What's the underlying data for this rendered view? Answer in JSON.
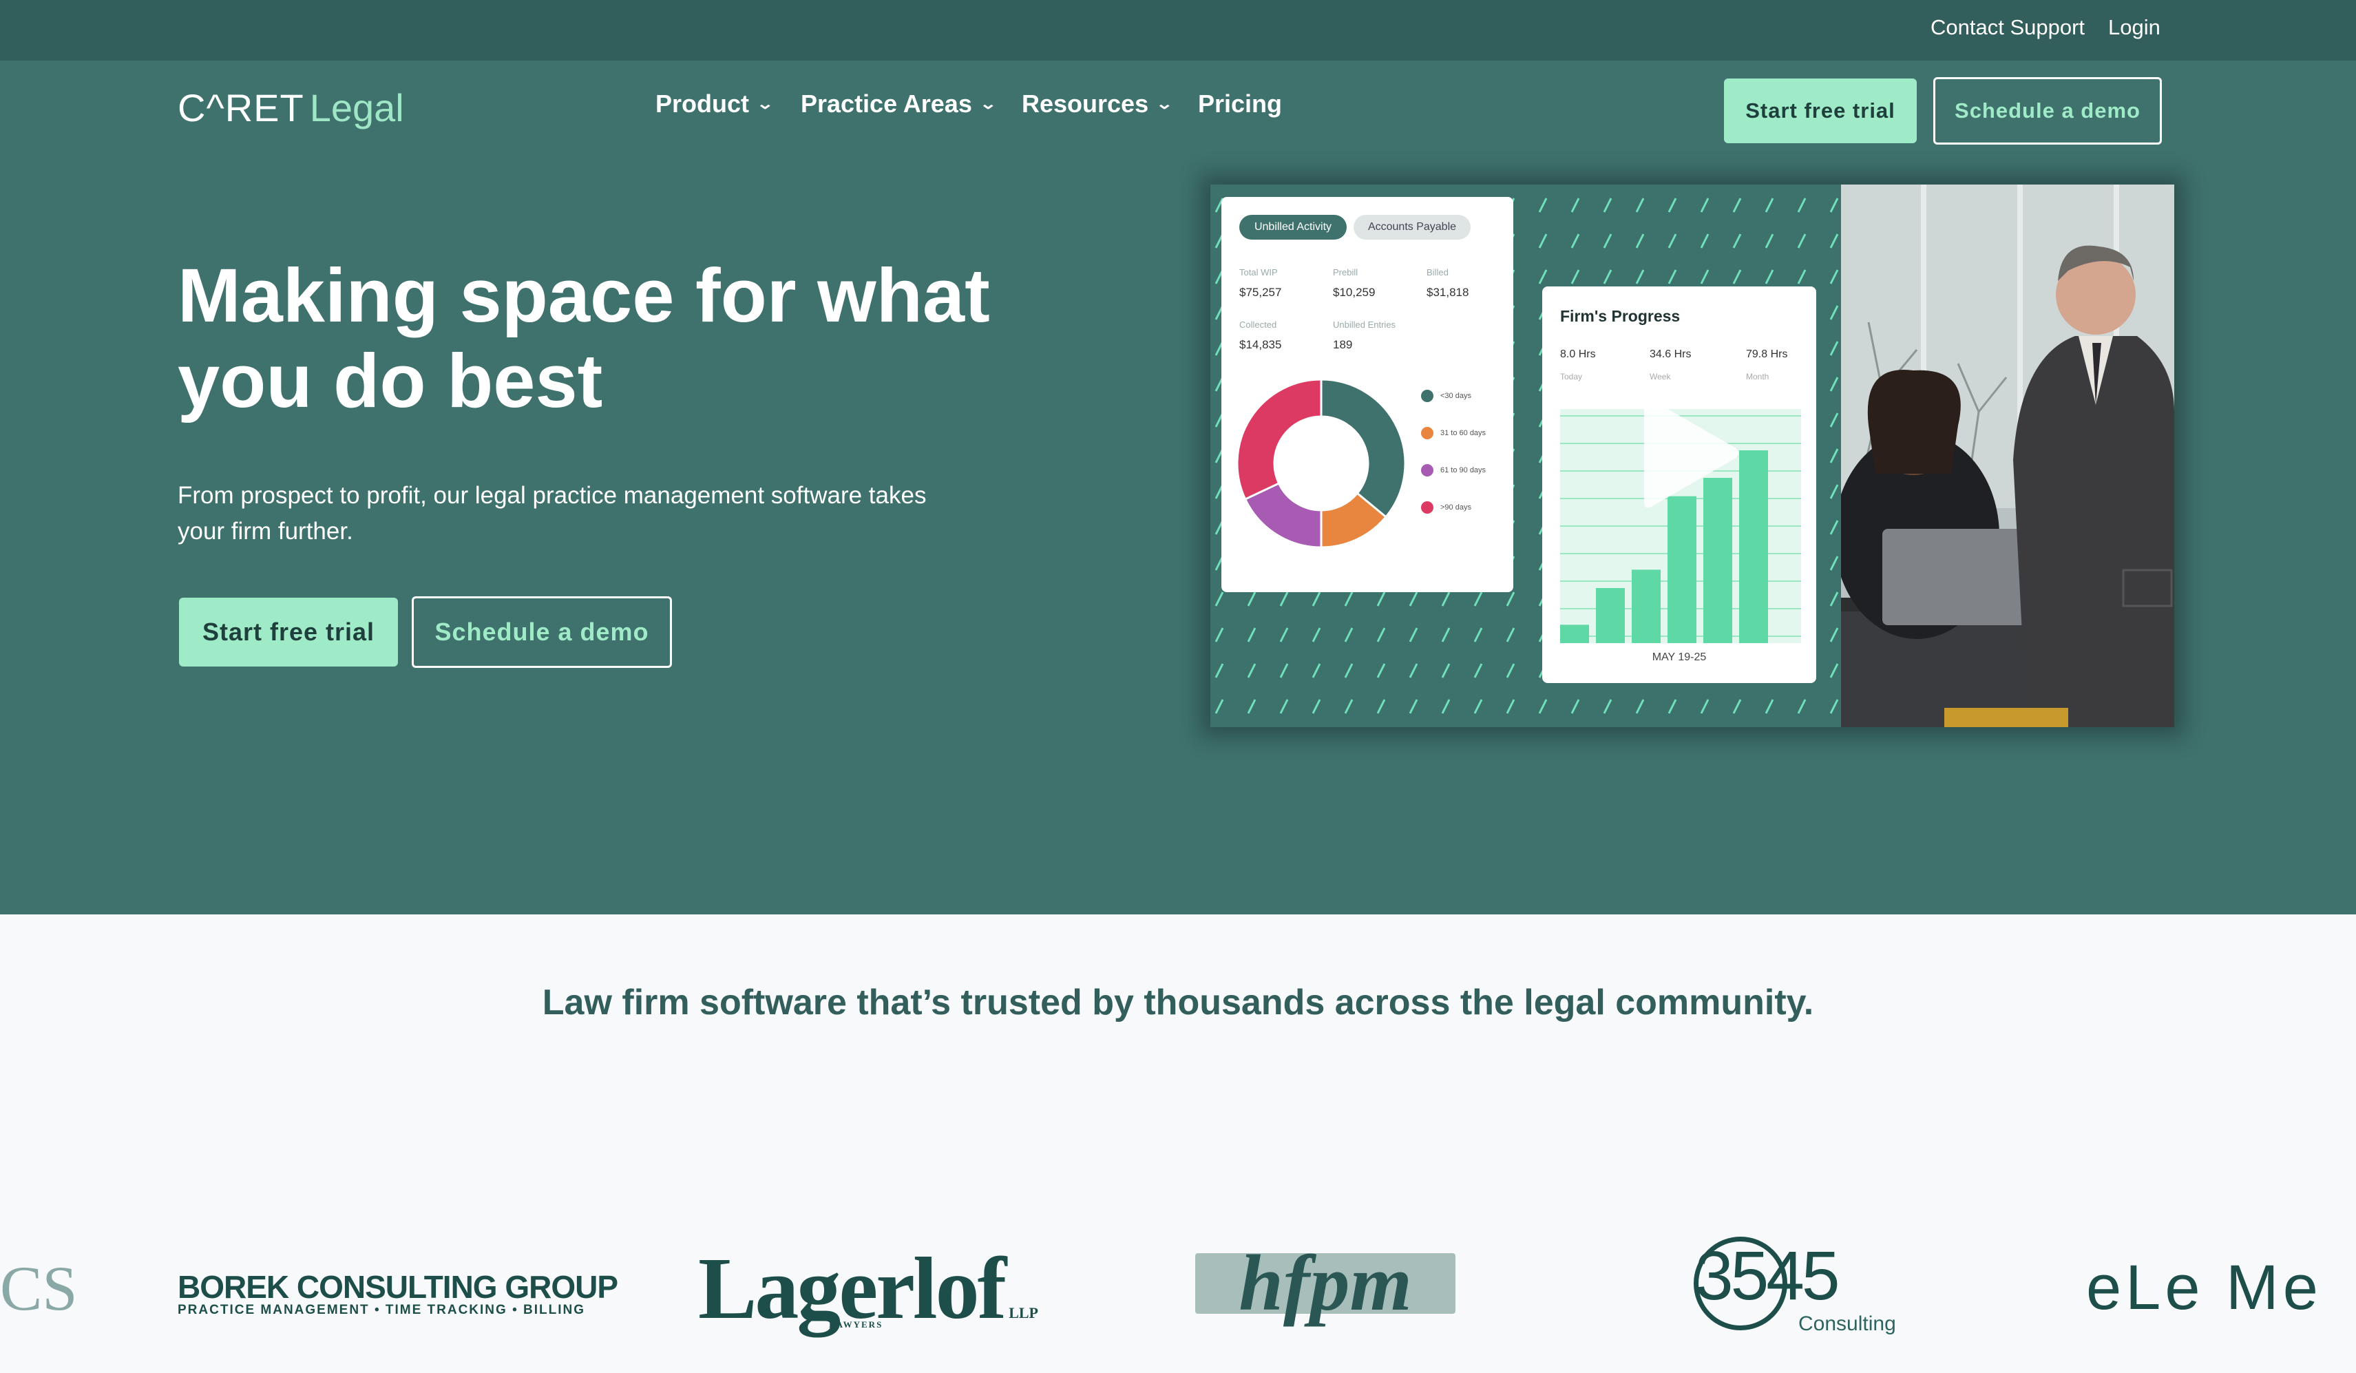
{
  "topbar": {
    "contact_label": "Contact Support",
    "login_label": "Login"
  },
  "brand": {
    "name_part1": "C^RET",
    "name_part2": "Legal"
  },
  "nav": {
    "items": [
      {
        "label": "Product"
      },
      {
        "label": "Practice Areas"
      },
      {
        "label": "Resources"
      },
      {
        "label": "Pricing"
      }
    ],
    "chevron_icon": "chevron-down-icon"
  },
  "header_buttons": {
    "trial_label": "Start free trial",
    "demo_label": "Schedule a demo"
  },
  "hero": {
    "headline": "Making space for what you do best",
    "subcopy": "From prospect to profit, our legal practice management software takes your firm further.",
    "trial_label": "Start free trial",
    "demo_label": "Schedule a demo"
  },
  "dashboard": {
    "tabs": [
      "Unbilled Activity",
      "Accounts Payable"
    ],
    "kpis": [
      {
        "label": "Total WIP",
        "value": "$75,257"
      },
      {
        "label": "Prebill",
        "value": "$10,259"
      },
      {
        "label": "Billed",
        "value": "$31,818"
      },
      {
        "label": "Collected",
        "value": "$14,835"
      },
      {
        "label": "Unbilled Entries",
        "value": "189"
      }
    ],
    "aging_legend": [
      "<30 days",
      "31 to 60 days",
      "61 to 90 days",
      ">90 days"
    ],
    "aging_colors": [
      "#3f716d",
      "#e8853e",
      "#a75bb3",
      "#dd3a63"
    ]
  },
  "progress": {
    "title": "Firm's Progress",
    "stats": [
      {
        "hours": "8.0 Hrs",
        "period": "Today"
      },
      {
        "hours": "34.6 Hrs",
        "period": "Week"
      },
      {
        "hours": "79.8 Hrs",
        "period": "Month"
      }
    ],
    "date_label": "MAY 19-25",
    "play_icon": "play-icon"
  },
  "trusted": {
    "heading": "Law firm software that’s trusted by thousands across the legal community."
  },
  "logos": {
    "cs": "CS",
    "borek_title": "BOREK  CONSULTING GROUP",
    "borek_sub": "PRACTICE MANAGEMENT  •  TIME TRACKING  •  BILLING",
    "lagerlof": "Lagerlof",
    "lagerlof_llp": "LLP",
    "lagerlof_lawyers": "LAWYERS",
    "hfpm": "hfpm",
    "n3545": "3545",
    "n3545_sub": "Consulting",
    "elem": "eLe Me"
  },
  "chart_data": {
    "type": "bar",
    "title": "Firm's Progress",
    "xlabel": "MAY 19-25",
    "ylabel": "",
    "values": [
      1,
      3,
      4,
      8,
      9,
      10.5
    ],
    "donut": {
      "categories": [
        "<30 days",
        "31 to 60 days",
        "61 to 90 days",
        ">90 days"
      ],
      "values": [
        36,
        14,
        18,
        32
      ]
    }
  }
}
